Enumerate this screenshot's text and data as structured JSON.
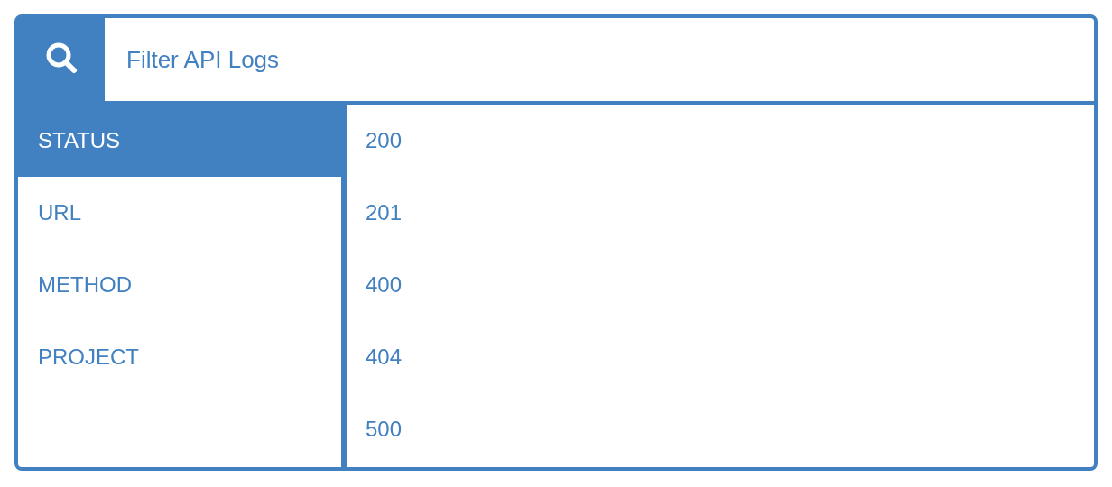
{
  "search": {
    "placeholder": "Filter API Logs"
  },
  "categories": [
    {
      "label": "STATUS",
      "selected": true
    },
    {
      "label": "URL",
      "selected": false
    },
    {
      "label": "METHOD",
      "selected": false
    },
    {
      "label": "PROJECT",
      "selected": false
    }
  ],
  "values": [
    {
      "label": "200",
      "selected": false
    },
    {
      "label": "201",
      "selected": false
    },
    {
      "label": "400",
      "selected": false
    },
    {
      "label": "404",
      "selected": false
    },
    {
      "label": "500",
      "selected": false
    }
  ]
}
